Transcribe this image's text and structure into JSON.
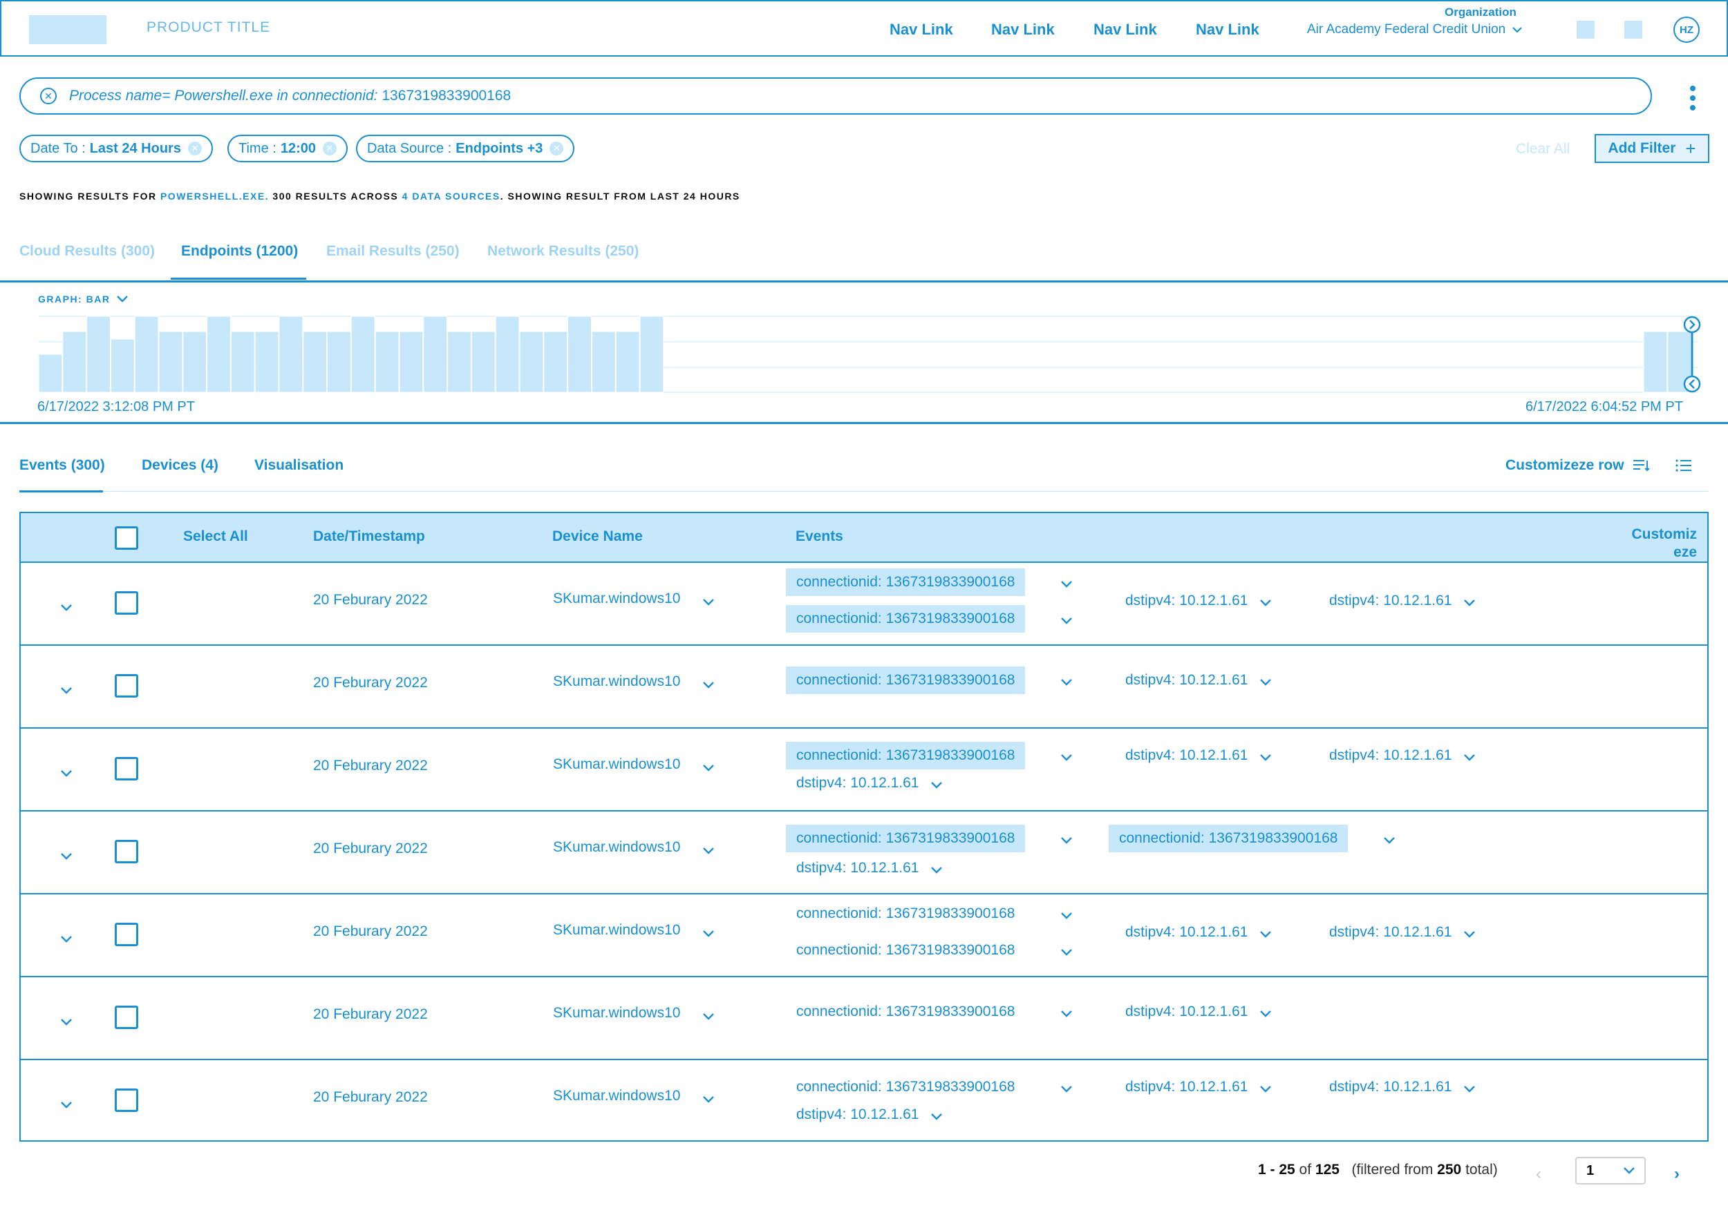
{
  "header": {
    "product_title": "PRODUCT TITLE",
    "nav_links": [
      "Nav Link",
      "Nav Link",
      "Nav Link",
      "Nav Link"
    ],
    "org_label": "Organization",
    "org_name": "Air Academy Federal Credit Union",
    "avatar_initials": "HZ"
  },
  "search": {
    "prefix": "Process name= Powershell.exe in connectionid: ",
    "value": "1367319833900168"
  },
  "filters": {
    "chips": [
      {
        "label": "Date To :",
        "value": "Last 24 Hours"
      },
      {
        "label": "Time :",
        "value": "12:00"
      },
      {
        "label": "Data Source :",
        "value": "Endpoints +3"
      }
    ],
    "clear_all": "Clear All",
    "add_filter": "Add Filter"
  },
  "summary": {
    "part1": "SHOWING RESULTS FOR ",
    "query": "POWERSHELL.EXE.",
    "part2": " 300 RESULTS ACROSS ",
    "sources": "4 DATA SOURCES",
    "part3": ". SHOWING RESULT FROM LAST 24 HOURS"
  },
  "result_tabs": [
    {
      "label": "Cloud Results (300)",
      "active": false
    },
    {
      "label": "Endpoints (1200)",
      "active": true
    },
    {
      "label": "Email Results (250)",
      "active": false
    },
    {
      "label": "Network Results (250)",
      "active": false
    }
  ],
  "graph": {
    "label": "GRAPH: BAR",
    "start_time": "6/17/2022 3:12:08 PM PT",
    "end_time": "6/17/2022 6:04:52 PM PT",
    "bars": [
      0.5,
      0.8,
      1.0,
      0.7,
      1.0,
      0.8,
      0.8,
      1.0,
      0.8,
      0.8,
      1.0,
      0.8,
      0.8,
      1.0,
      0.8,
      0.8,
      1.0,
      0.8,
      0.8,
      1.0,
      0.8,
      0.8,
      1.0,
      0.8,
      0.8,
      1.0
    ],
    "tail_bars": [
      0.8,
      0.8
    ]
  },
  "view_tabs": {
    "events": "Events (300)",
    "devices": "Devices (4)",
    "visualisation": "Visualisation",
    "customize_row": "Customizeze row"
  },
  "table": {
    "headers": {
      "select_all": "Select All",
      "timestamp": "Date/Timestamp",
      "device": "Device Name",
      "events": "Events",
      "customize": "Customiz eze"
    },
    "rows": [
      {
        "date": "20 Feburary 2022",
        "device": "SKumar.windows10",
        "variant": 1
      },
      {
        "date": "20 Feburary 2022",
        "device": "SKumar.windows10",
        "variant": 2
      },
      {
        "date": "20 Feburary 2022",
        "device": "SKumar.windows10",
        "variant": 3
      },
      {
        "date": "20 Feburary 2022",
        "device": "SKumar.windows10",
        "variant": 4
      },
      {
        "date": "20 Feburary 2022",
        "device": "SKumar.windows10",
        "variant": 5
      },
      {
        "date": "20 Feburary 2022",
        "device": "SKumar.windows10",
        "variant": 6
      },
      {
        "date": "20 Feburary 2022",
        "device": "SKumar.windows10",
        "variant": 7
      }
    ],
    "event_conn": "connectionid: 1367319833900168",
    "event_dst": "dstipv4: 10.12.1.61"
  },
  "pagination": {
    "range": "1 - 25",
    "of": "of",
    "total": "125",
    "filtered_pre": "(filtered from",
    "filtered_total": "250",
    "filtered_post": "total)",
    "page": "1"
  },
  "colors": {
    "accent": "#1a8fd1",
    "light": "#c7e8fb",
    "faded": "#9fd3f2"
  }
}
